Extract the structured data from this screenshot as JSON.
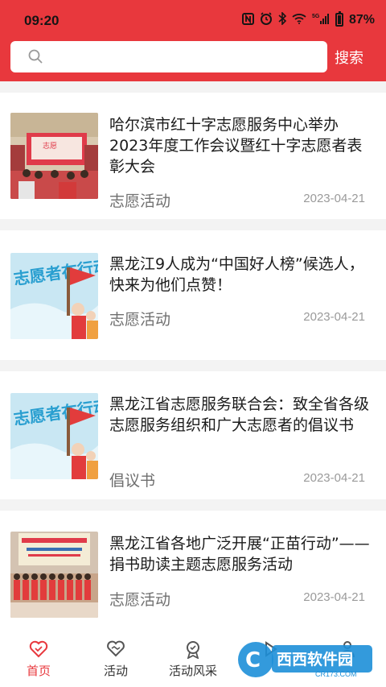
{
  "status_bar": {
    "time": "09:20",
    "network": "5G",
    "battery": "87%"
  },
  "search": {
    "placeholder": "",
    "button_label": "搜索"
  },
  "articles": [
    {
      "title": "哈尔滨市红十字志愿服务中心举办2023年度工作会议暨红十字志愿者表彰大会",
      "category": "志愿活动",
      "date": "2023-04-21",
      "thumb_icon": "conference-photo"
    },
    {
      "title": "黑龙江9人成为“中国好人榜”候选人，快来为他们点赞！",
      "category": "志愿活动",
      "date": "2023-04-21",
      "thumb_text": "志愿者在行动"
    },
    {
      "title": "黑龙江省志愿服务联合会：致全省各级志愿服务组织和广大志愿者的倡议书",
      "category": "倡议书",
      "date": "2023-04-21",
      "thumb_text": "志愿者在行动"
    },
    {
      "title": "黑龙江省各地广泛开展“正苗行动”——捐书助读主题志愿服务活动",
      "category": "志愿活动",
      "date": "2023-04-21",
      "thumb_icon": "group-photo"
    }
  ],
  "tabs": [
    {
      "label": "首页",
      "icon": "heart-outline-icon",
      "active": true
    },
    {
      "label": "活动",
      "icon": "handshake-heart-icon",
      "active": false
    },
    {
      "label": "活动风采",
      "icon": "medal-icon",
      "active": false
    },
    {
      "label": "",
      "icon": "play-icon",
      "active": false
    },
    {
      "label": "",
      "icon": "user-icon",
      "active": false
    }
  ],
  "watermark": {
    "brand": "西西软件园",
    "domain": "CR173.COM"
  },
  "colors": {
    "brand_red": "#e8383d",
    "divider": "#f3f3f3"
  }
}
